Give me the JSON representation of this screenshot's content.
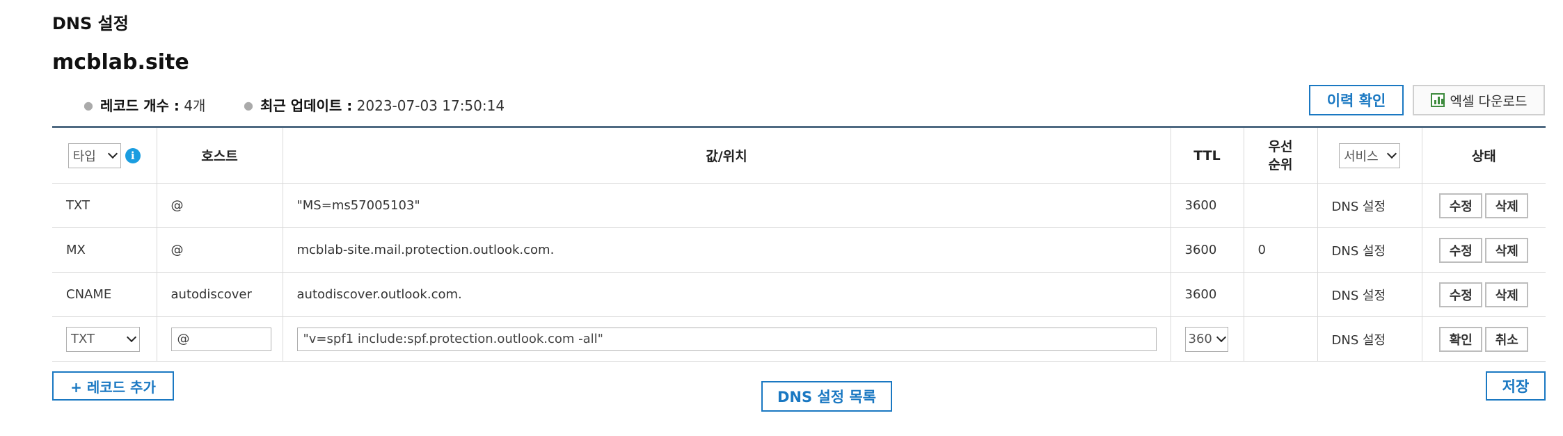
{
  "section_title": "DNS 설정",
  "domain": "mcblab.site",
  "summary": {
    "record_count_label": "레코드 개수 :",
    "record_count_value": "4개",
    "updated_label": "최근 업데이트 :",
    "updated_value": "2023-07-03 17:50:14"
  },
  "actions": {
    "history_button": "이력 확인",
    "excel_button": "엑셀 다운로드",
    "add_record_button": "+ 레코드 추가",
    "list_button": "DNS 설정 목록",
    "save_button": "저장"
  },
  "table": {
    "headers": {
      "type_filter": "타입",
      "info_icon": "i",
      "host": "호스트",
      "value": "값/위치",
      "ttl": "TTL",
      "priority_line1": "우선",
      "priority_line2": "순위",
      "service_filter": "서비스",
      "status": "상태"
    },
    "rows": [
      {
        "type": "TXT",
        "host": "@",
        "value": "\"MS=ms57005103\"",
        "ttl": "3600",
        "priority": "",
        "service": "DNS 설정",
        "edit": "수정",
        "delete": "삭제"
      },
      {
        "type": "MX",
        "host": "@",
        "value": "mcblab-site.mail.protection.outlook.com.",
        "ttl": "3600",
        "priority": "0",
        "service": "DNS 설정",
        "edit": "수정",
        "delete": "삭제"
      },
      {
        "type": "CNAME",
        "host": "autodiscover",
        "value": "autodiscover.outlook.com.",
        "ttl": "3600",
        "priority": "",
        "service": "DNS 설정",
        "edit": "수정",
        "delete": "삭제"
      }
    ],
    "edit_row": {
      "type": "TXT",
      "host": "@",
      "value": "\"v=spf1 include:spf.protection.outlook.com -all\"",
      "ttl": "360",
      "service": "DNS 설정",
      "confirm": "확인",
      "cancel": "취소"
    }
  },
  "icons": {
    "info": "info-icon",
    "excel": "spreadsheet-chart-icon",
    "dropdown": "chevron-down-icon"
  },
  "colors": {
    "accent": "#1a78c2",
    "info": "#1a9de0",
    "excel_green": "#3d8b3d",
    "table_top_border": "#4f6a82"
  }
}
